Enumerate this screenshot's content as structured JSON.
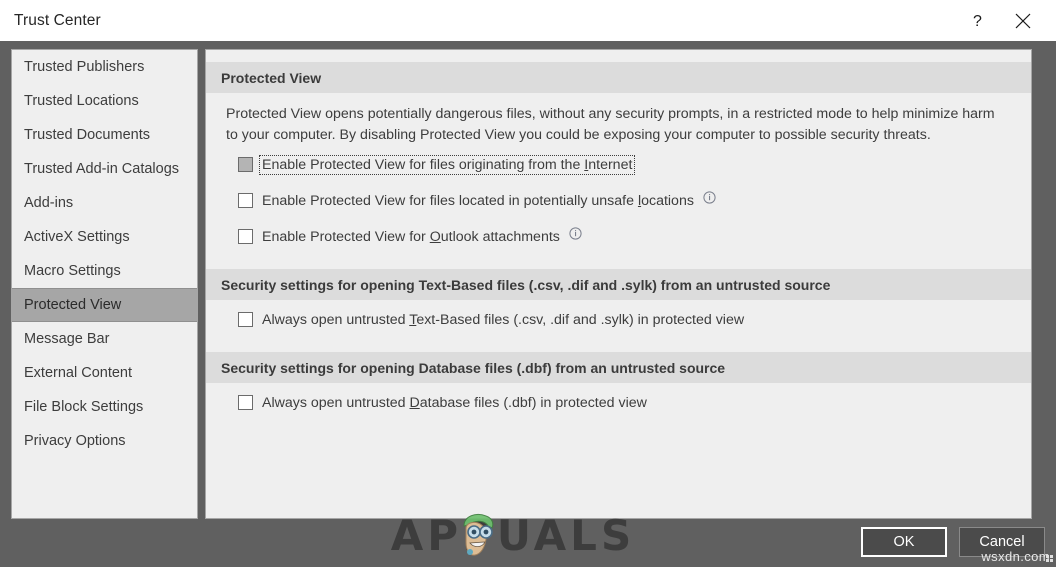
{
  "window": {
    "title": "Trust Center",
    "help_icon": "question-mark-icon",
    "close_icon": "close-icon"
  },
  "sidebar": {
    "items": [
      {
        "label": "Trusted Publishers",
        "selected": false
      },
      {
        "label": "Trusted Locations",
        "selected": false
      },
      {
        "label": "Trusted Documents",
        "selected": false
      },
      {
        "label": "Trusted Add-in Catalogs",
        "selected": false
      },
      {
        "label": "Add-ins",
        "selected": false
      },
      {
        "label": "ActiveX Settings",
        "selected": false
      },
      {
        "label": "Macro Settings",
        "selected": false
      },
      {
        "label": "Protected View",
        "selected": true
      },
      {
        "label": "Message Bar",
        "selected": false
      },
      {
        "label": "External Content",
        "selected": false
      },
      {
        "label": "File Block Settings",
        "selected": false
      },
      {
        "label": "Privacy Options",
        "selected": false
      }
    ]
  },
  "content": {
    "section1": {
      "header": "Protected View",
      "description": "Protected View opens potentially dangerous files, without any security prompts, in a restricted mode to help minimize harm to your computer. By disabling Protected View you could be exposing your computer to possible security threats.",
      "checkboxes": [
        {
          "label_pre": "Enable Protected View for files originating from the ",
          "label_accel": "I",
          "label_post": "nternet",
          "checked": false,
          "pressed": true,
          "focused": true,
          "info": false
        },
        {
          "label_pre": "Enable Protected View for files located in potentially unsafe ",
          "label_accel": "l",
          "label_post": "ocations",
          "checked": false,
          "pressed": false,
          "focused": false,
          "info": true
        },
        {
          "label_pre": "Enable Protected View for ",
          "label_accel": "O",
          "label_post": "utlook attachments",
          "checked": false,
          "pressed": false,
          "focused": false,
          "info": true
        }
      ]
    },
    "section2": {
      "header": "Security settings for opening Text-Based files (.csv, .dif and .sylk) from an untrusted source",
      "checkboxes": [
        {
          "label_pre": "Always open untrusted ",
          "label_accel": "T",
          "label_post": "ext-Based files (.csv, .dif and .sylk) in protected view",
          "checked": false,
          "pressed": false,
          "focused": false,
          "info": false
        }
      ]
    },
    "section3": {
      "header": "Security settings for opening Database files (.dbf) from an untrusted source",
      "checkboxes": [
        {
          "label_pre": "Always open untrusted ",
          "label_accel": "D",
          "label_post": "atabase files (.dbf) in protected view",
          "checked": false,
          "pressed": false,
          "focused": false,
          "info": false
        }
      ]
    }
  },
  "footer": {
    "ok_label": "OK",
    "cancel_label": "Cancel"
  },
  "watermarks": {
    "brand": "APPUALS",
    "site": "wsxdn.com"
  },
  "colors": {
    "dialog_frame": "#606060",
    "panel_bg": "#efefef",
    "panel_border": "#a6a6a6",
    "section_header_bg": "#dcdcdc",
    "selected_item_bg": "#a6a6a6",
    "button_bg": "#4b4b4b",
    "text": "#3d3d3d"
  }
}
